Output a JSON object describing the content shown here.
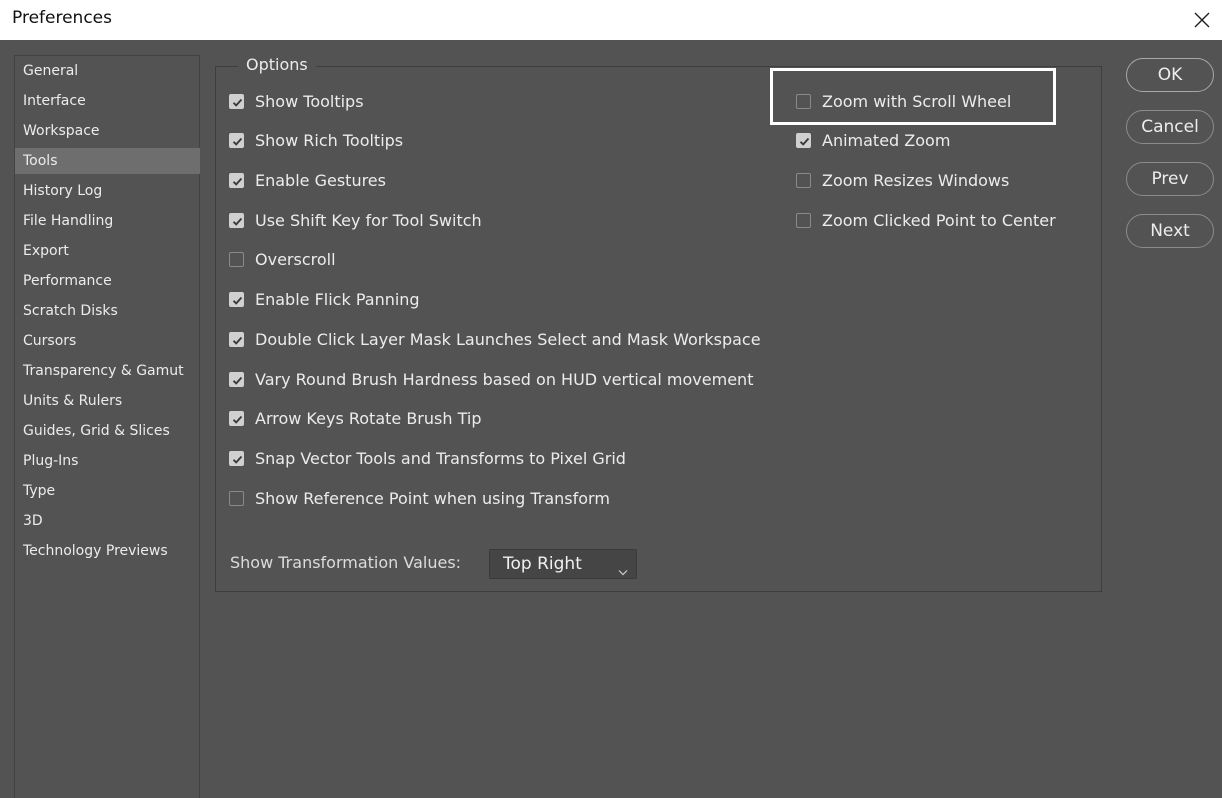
{
  "window": {
    "title": "Preferences"
  },
  "sidebar": {
    "items": [
      {
        "label": "General"
      },
      {
        "label": "Interface"
      },
      {
        "label": "Workspace"
      },
      {
        "label": "Tools",
        "active": true
      },
      {
        "label": "History Log"
      },
      {
        "label": "File Handling"
      },
      {
        "label": "Export"
      },
      {
        "label": "Performance"
      },
      {
        "label": "Scratch Disks"
      },
      {
        "label": "Cursors"
      },
      {
        "label": "Transparency & Gamut"
      },
      {
        "label": "Units & Rulers"
      },
      {
        "label": "Guides, Grid & Slices"
      },
      {
        "label": "Plug-Ins"
      },
      {
        "label": "Type"
      },
      {
        "label": "3D"
      },
      {
        "label": "Technology Previews"
      }
    ]
  },
  "options": {
    "legend": "Options",
    "left": [
      {
        "label": "Show Tooltips",
        "checked": true
      },
      {
        "label": "Show Rich Tooltips",
        "checked": true
      },
      {
        "label": "Enable Gestures",
        "checked": true
      },
      {
        "label": "Use Shift Key for Tool Switch",
        "checked": true
      },
      {
        "label": "Overscroll",
        "checked": false
      },
      {
        "label": "Enable Flick Panning",
        "checked": true
      },
      {
        "label": "Double Click Layer Mask Launches Select and Mask Workspace",
        "checked": true
      },
      {
        "label": "Vary Round Brush Hardness based on HUD vertical movement",
        "checked": true
      },
      {
        "label": "Arrow Keys Rotate Brush Tip",
        "checked": true
      },
      {
        "label": "Snap Vector Tools and Transforms to Pixel Grid",
        "checked": true
      },
      {
        "label": "Show Reference Point when using Transform",
        "checked": false
      }
    ],
    "right": [
      {
        "label": "Zoom with Scroll Wheel",
        "checked": false
      },
      {
        "label": "Animated Zoom",
        "checked": true
      },
      {
        "label": "Zoom Resizes Windows",
        "checked": false
      },
      {
        "label": "Zoom Clicked Point to Center",
        "checked": false
      }
    ],
    "transform_values": {
      "label": "Show Transformation Values:",
      "selected": "Top Right"
    }
  },
  "buttons": {
    "ok": "OK",
    "cancel": "Cancel",
    "prev": "Prev",
    "next": "Next"
  }
}
